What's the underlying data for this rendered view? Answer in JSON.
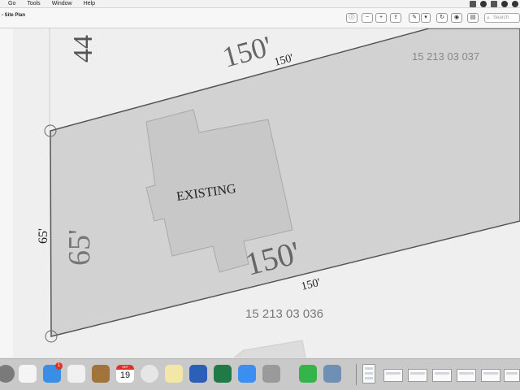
{
  "menubar": {
    "items": [
      "Go",
      "Tools",
      "Window",
      "Help"
    ]
  },
  "window": {
    "title": "- Site Plan"
  },
  "toolbar": {
    "search_placeholder": "Search"
  },
  "plan": {
    "labels": {
      "street_number": "44",
      "top_side_large": "150'",
      "top_side_small": "150'",
      "bottom_side_large": "150'",
      "bottom_side_small": "150'",
      "left_side_outer": "65'",
      "left_side_inner": "65'",
      "existing": "EXISTING",
      "parcel_top": "15 213 03 037",
      "parcel_bottom": "15 213 03 036"
    }
  },
  "dock": {
    "mail_badge": "1",
    "calendar_day": "19",
    "calendar_month": "SEP"
  }
}
